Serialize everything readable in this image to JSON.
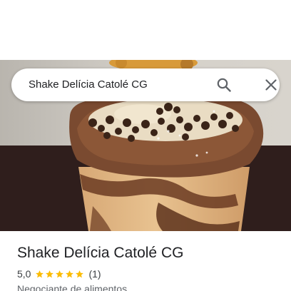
{
  "search": {
    "query": "Shake Delícia Catolé CG",
    "search_icon": "search-icon",
    "close_icon": "close-icon"
  },
  "hero": {
    "image": "milkshake-photo"
  },
  "place": {
    "title": "Shake Delícia Catolé CG",
    "rating": "5,0",
    "rating_value": 5.0,
    "stars_filled": 5,
    "stars_total": 5,
    "review_count": "(1)",
    "category": "Negociante de alimentos"
  },
  "colors": {
    "star": "#fbbc04",
    "title_text": "#202124",
    "secondary_text": "#5f6368",
    "icon": "#5f6368"
  }
}
